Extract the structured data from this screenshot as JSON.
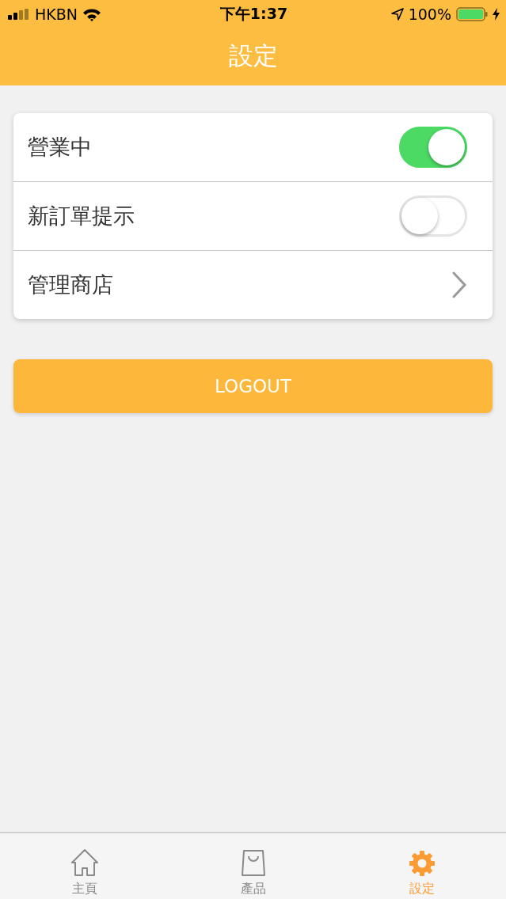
{
  "status_bar": {
    "carrier": "HKBN",
    "time": "下午1:37",
    "battery": "100%"
  },
  "header": {
    "title": "設定"
  },
  "settings": [
    {
      "kind": "toggle",
      "label": "營業中",
      "on": true
    },
    {
      "kind": "toggle",
      "label": "新訂單提示",
      "on": false
    },
    {
      "kind": "link",
      "label": "管理商店"
    }
  ],
  "logout_button": "LOGOUT",
  "tabs": [
    {
      "kind": "home",
      "label": "主頁",
      "selected": false
    },
    {
      "kind": "bag",
      "label": "產品",
      "selected": false
    },
    {
      "kind": "gear",
      "label": "設定",
      "selected": true
    }
  ]
}
